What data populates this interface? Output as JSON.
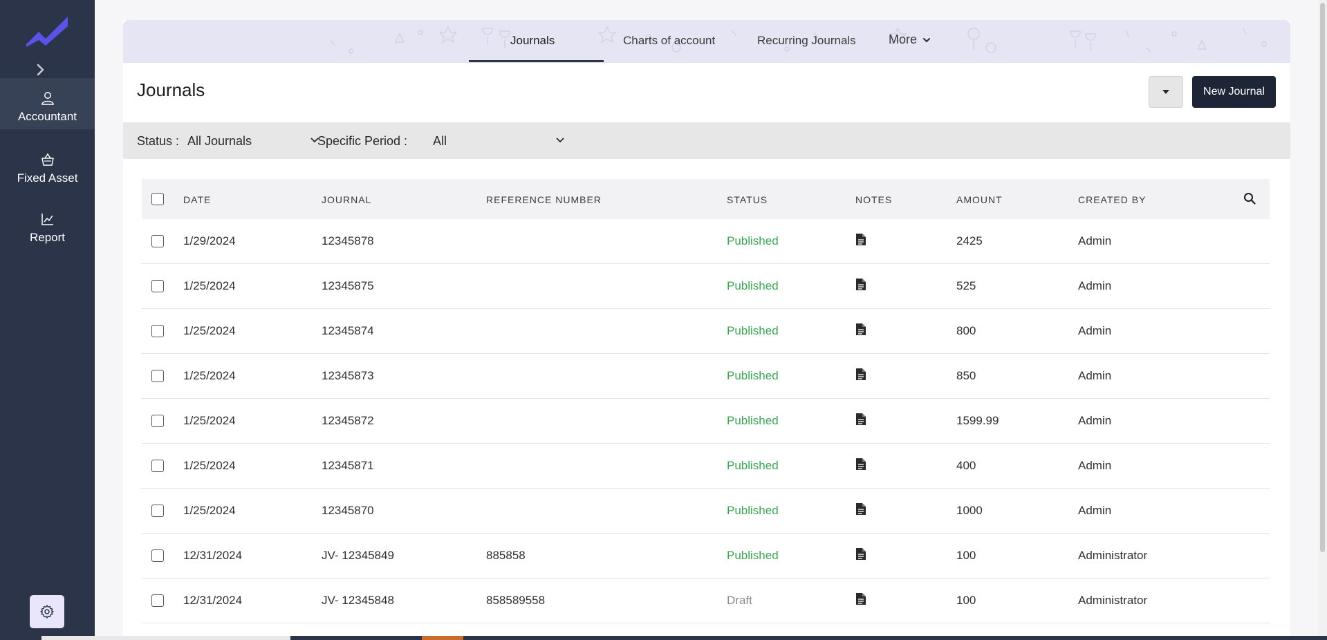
{
  "sidebar": {
    "items": [
      {
        "label": "Accountant",
        "icon": "user-icon"
      },
      {
        "label": "Fixed Asset",
        "icon": "basket-icon"
      },
      {
        "label": "Report",
        "icon": "chart-line-icon"
      }
    ],
    "settings_icon": "gear-icon"
  },
  "tabs": [
    {
      "label": "Journals"
    },
    {
      "label": "Charts of account"
    },
    {
      "label": "Recurring Journals"
    },
    {
      "label": "More"
    }
  ],
  "page": {
    "title": "Journals",
    "new_button": "New Journal"
  },
  "filters": {
    "status_label": "Status :",
    "status_value": "All Journals",
    "period_label": "Specific Period :",
    "period_value": "All"
  },
  "table": {
    "columns": [
      "DATE",
      "JOURNAL",
      "REFERENCE NUMBER",
      "STATUS",
      "NOTES",
      "AMOUNT",
      "CREATED BY"
    ],
    "rows": [
      {
        "date": "1/29/2024",
        "journal": "12345878",
        "ref": "",
        "status": "Published",
        "amount": "2425",
        "created_by": "Admin"
      },
      {
        "date": "1/25/2024",
        "journal": "12345875",
        "ref": "",
        "status": "Published",
        "amount": "525",
        "created_by": "Admin"
      },
      {
        "date": "1/25/2024",
        "journal": "12345874",
        "ref": "",
        "status": "Published",
        "amount": "800",
        "created_by": "Admin"
      },
      {
        "date": "1/25/2024",
        "journal": "12345873",
        "ref": "",
        "status": "Published",
        "amount": "850",
        "created_by": "Admin"
      },
      {
        "date": "1/25/2024",
        "journal": "12345872",
        "ref": "",
        "status": "Published",
        "amount": "1599.99",
        "created_by": "Admin"
      },
      {
        "date": "1/25/2024",
        "journal": "12345871",
        "ref": "",
        "status": "Published",
        "amount": "400",
        "created_by": "Admin"
      },
      {
        "date": "1/25/2024",
        "journal": "12345870",
        "ref": "",
        "status": "Published",
        "amount": "1000",
        "created_by": "Admin"
      },
      {
        "date": "12/31/2024",
        "journal": "JV- 12345849",
        "ref": "885858",
        "status": "Published",
        "amount": "100",
        "created_by": "Administrator"
      },
      {
        "date": "12/31/2024",
        "journal": "JV- 12345848",
        "ref": "858589558",
        "status": "Draft",
        "amount": "100",
        "created_by": "Administrator"
      }
    ]
  },
  "colors": {
    "sidebar": "#2b3448",
    "published": "#3fa356",
    "draft": "#8a8a8a",
    "accent_dark": "#1e2536",
    "tabbar": "#e5e5f4",
    "logo": "#5b52e8"
  }
}
